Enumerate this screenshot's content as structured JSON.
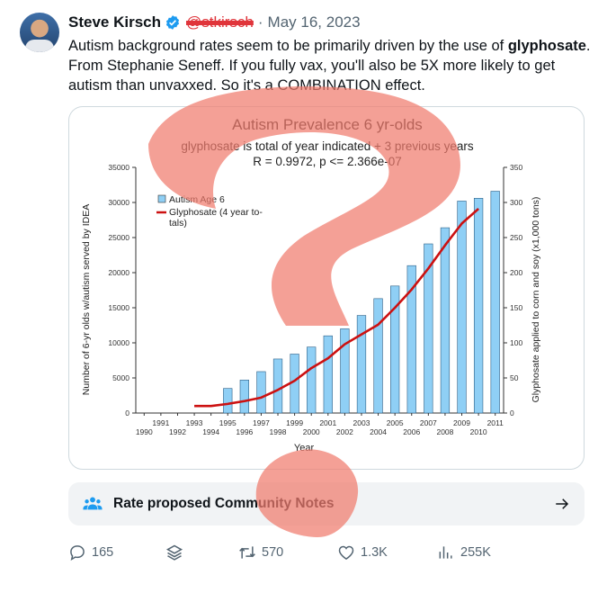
{
  "tweet": {
    "author_name": "Steve Kirsch",
    "handle": "@stkirsch",
    "separator": "·",
    "date": "May 16, 2023",
    "text_before": "Autism background rates seem to be primarily driven by the use of ",
    "text_bold": "glyphosate",
    "text_after": ". From Stephanie Seneff. If you fully vax, you'll also be 5X more likely to get autism than unvaxxed. So it's a COMBINATION effect."
  },
  "chart_data": {
    "type": "bar",
    "title": "Autism Prevalence 6 yr-olds",
    "subtitle": "glyphosate is total of year indicated + 3 previous years",
    "subtitle2": "R = 0.9972, p <= 2.366e-07",
    "xlabel": "Year",
    "ylabel": "Number of 6-yr olds w/autism served by IDEA",
    "y2label": "Glyphosate applied to corn and soy (x1,000 tons)",
    "ylim": [
      0,
      35000
    ],
    "y2lim": [
      0,
      350
    ],
    "yticks": [
      "0",
      "5000",
      "10000",
      "15000",
      "20000",
      "25000",
      "30000",
      "35000"
    ],
    "y2ticks": [
      "0",
      "50",
      "100",
      "150",
      "200",
      "250",
      "300",
      "350"
    ],
    "categories": [
      "1990",
      "1991",
      "1992",
      "1993",
      "1994",
      "1995",
      "1996",
      "1997",
      "1998",
      "1999",
      "2000",
      "2001",
      "2002",
      "2003",
      "2004",
      "2005",
      "2006",
      "2007",
      "2008",
      "2009",
      "2010",
      "2011"
    ],
    "legend_position": "top-left",
    "grid": false,
    "series": [
      {
        "name": "Autism Age 6",
        "kind": "bar",
        "axis": "left",
        "color": "#8fcff5",
        "values": [
          null,
          null,
          null,
          null,
          null,
          3500,
          4700,
          5900,
          7700,
          8400,
          9400,
          11000,
          12000,
          13900,
          16300,
          18100,
          21000,
          24100,
          26400,
          30200,
          30600,
          31600
        ]
      },
      {
        "name": "Glyphosate (4 year to-tals)",
        "kind": "line",
        "axis": "right",
        "color": "#cc1111",
        "values": [
          null,
          null,
          null,
          10,
          10,
          13,
          17,
          22,
          33,
          46,
          64,
          78,
          98,
          112,
          126,
          150,
          176,
          206,
          239,
          270,
          291,
          null
        ]
      }
    ]
  },
  "community_notes": {
    "label": "Rate proposed Community Notes"
  },
  "actions": {
    "replies": "165",
    "retweets": "570",
    "likes": "1.3K",
    "views": "255K"
  },
  "colors": {
    "accent": "#1d9bf0",
    "muted_text": "#536471",
    "overlay": "#f07c6e"
  },
  "icons": [
    "verified-icon",
    "people-icon",
    "arrow-right-icon",
    "reply-icon",
    "layers-icon",
    "retweet-icon",
    "heart-icon",
    "views-icon"
  ]
}
